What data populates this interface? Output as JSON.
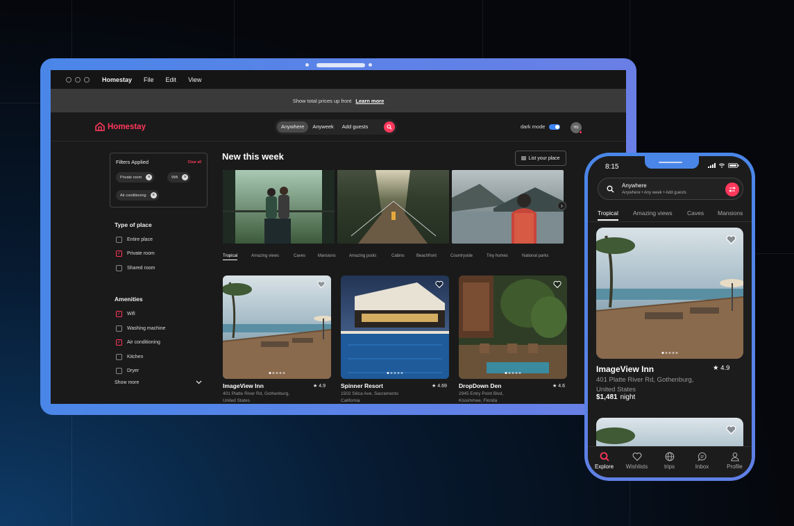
{
  "laptop": {
    "menubar": {
      "app": "Homestay",
      "items": [
        "File",
        "Edit",
        "View"
      ]
    },
    "banner": {
      "text": "Show total prices up front",
      "link": "Learn more"
    },
    "logo": "Homestay",
    "search": {
      "seg1": "Anywhere",
      "seg2": "Anyweek",
      "seg3": "Add guests"
    },
    "dark_mode_label": "dark mode",
    "avatar_initials": "HS",
    "filters": {
      "title": "Filters Applied",
      "clear": "Clear all",
      "chips": [
        "Private room",
        "Wifi",
        "Air conditioning"
      ]
    },
    "type_of_place": {
      "title": "Type of place",
      "options": [
        {
          "label": "Entire place",
          "checked": false
        },
        {
          "label": "Private room",
          "checked": true
        },
        {
          "label": "Shared room",
          "checked": false
        }
      ]
    },
    "amenities": {
      "title": "Amenities",
      "options": [
        {
          "label": "Wifi",
          "checked": true
        },
        {
          "label": "Washing machine",
          "checked": false
        },
        {
          "label": "Air conditioning",
          "checked": true
        },
        {
          "label": "Kitchen",
          "checked": false
        },
        {
          "label": "Dryer",
          "checked": false
        }
      ],
      "show_more": "Show more"
    },
    "new_this_week": "New this week",
    "list_your_place": "List your place",
    "categories": [
      "Tropical",
      "Amazing views",
      "Caves",
      "Mansions",
      "Amazing pools",
      "Cabins",
      "Beachfront",
      "Countryside",
      "Tiny homes",
      "National parks"
    ],
    "listings": [
      {
        "name": "ImageView Inn",
        "rating": "4.9",
        "address": "401 Platte River Rd, Gothenburg,",
        "address2": "United States"
      },
      {
        "name": "Spinner Resort",
        "rating": "4.69",
        "address": "1502 Silica Ave, Sacramento",
        "address2": "California"
      },
      {
        "name": "DropDown Den",
        "rating": "4.6",
        "address": "2945 Entry Point Blvd,",
        "address2": "Kissimmee, Florida"
      }
    ]
  },
  "phone": {
    "time": "8:15",
    "search_title": "Anywhere",
    "search_sub": "Anywhere • Any week • Add guests",
    "tabs": [
      "Tropical",
      "Amazing views",
      "Caves",
      "Mansions"
    ],
    "listing": {
      "name": "ImageView Inn",
      "rating": "4.9",
      "address": "401 Platte River Rd, Gothenburg, United States",
      "price": "$1,481",
      "unit": "night"
    },
    "nav": [
      "Explore",
      "Wishlists",
      "trips",
      "Inbox",
      "Profile"
    ]
  },
  "colors": {
    "accent": "#ff385c",
    "frame": "#4a86e8"
  }
}
